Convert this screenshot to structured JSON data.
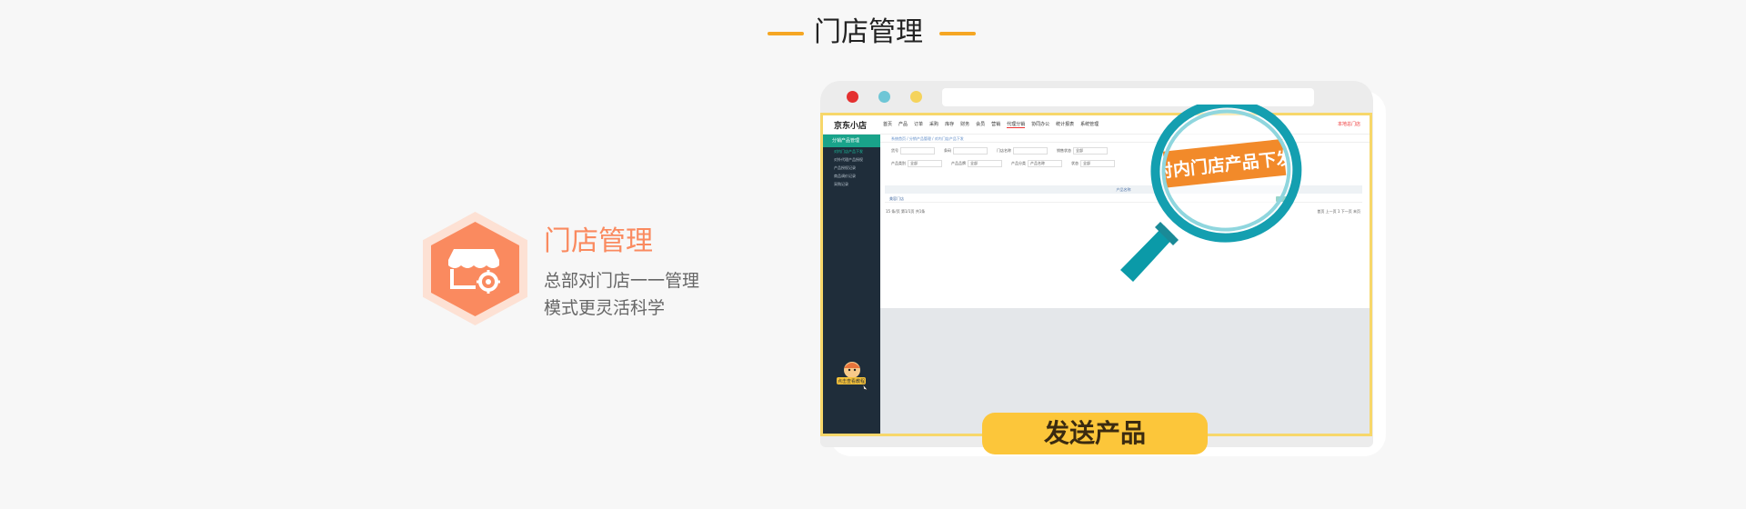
{
  "section": {
    "title": "门店管理"
  },
  "feature": {
    "title": "门店管理",
    "desc_line1": "总部对门店一一管理",
    "desc_line2": "模式更灵活科学",
    "accent_color": "#fa8a5f",
    "icon": "store-settings-icon"
  },
  "browser": {
    "app": {
      "logo": "京东小店",
      "menu": [
        "首页",
        "产品",
        "订单",
        "采购",
        "库存",
        "财务",
        "会员",
        "营销",
        "代理分销",
        "协同办公",
        "统计报表",
        "系统管理"
      ],
      "active_menu": "代理分销",
      "top_right": "本地总门店",
      "sidebar_head": "分销产品管理",
      "sidebar_items": [
        "对内门店产品下发",
        "对外代理产品授权",
        "产品授权记录",
        "商品调价记录",
        "采购记录"
      ],
      "breadcrumb": "系统首页 / 分销产品管理 / 对内门店产品下发",
      "filters_row1": [
        {
          "label": "货号",
          "value": ""
        },
        {
          "label": "条码",
          "value": ""
        },
        {
          "label": "门店名称",
          "value": ""
        },
        {
          "label": "销售状态",
          "value": "全部"
        }
      ],
      "filters_row2": [
        {
          "label": "产品类别",
          "value": "全部"
        },
        {
          "label": "产品品牌",
          "value": "全部"
        },
        {
          "label": "产品分类",
          "value": "产品名称"
        },
        {
          "label": "状态",
          "value": "全部"
        }
      ],
      "table_header": "产品名称",
      "table_row": "美容门店",
      "pager_left": "15 条/页  第1/1页 共1条",
      "pager_right": "首页 上一页 1 下一页 末页"
    },
    "magnifier_text": "对内门店产品下发",
    "mascot_label": "点击查看教程"
  },
  "cta": {
    "label": "发送产品",
    "color": "#fcc63a"
  }
}
